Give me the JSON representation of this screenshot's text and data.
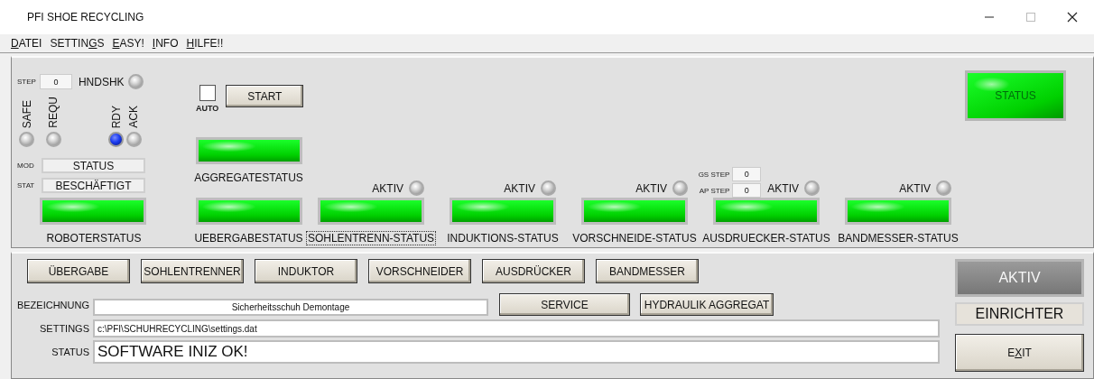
{
  "window": {
    "title": "PFI SHOE RECYCLING"
  },
  "menu": [
    {
      "key": "D",
      "rest": "ATEI"
    },
    {
      "lead": "SETTIN",
      "key": "G",
      "rest": "S"
    },
    {
      "key": "E",
      "rest": "ASY!"
    },
    {
      "key": "I",
      "rest": "NFO"
    },
    {
      "key": "H",
      "rest": "ILFE!!"
    }
  ],
  "robot": {
    "step_label": "STEP",
    "step": "0",
    "handshake_label": "HNDSHK",
    "handshake_on": false,
    "signals": [
      {
        "label": "SAFE",
        "on": false
      },
      {
        "label": "REQU",
        "on": false
      },
      {
        "label": "RDY",
        "on": true
      },
      {
        "label": "ACK",
        "on": false
      }
    ],
    "mod_label": "MOD",
    "mod": "STATUS",
    "stat_label": "STAT",
    "stat": "BESCHÄFTIGT",
    "status": {
      "label": "ROBOTERSTATUS",
      "on": true
    }
  },
  "start": {
    "auto_label": "AUTO",
    "auto_checked": false,
    "button": "START"
  },
  "aggregate": {
    "label": "AGGREGATESTATUS",
    "on": true
  },
  "transfer": {
    "label": "UEBERGABESTATUS",
    "on": true,
    "focused": false
  },
  "stations": [
    {
      "label": "SOHLENTRENN-STATUS",
      "on": true,
      "focused": true,
      "aktiv_label": "AKTIV",
      "aktiv_on": false
    },
    {
      "label": "INDUKTIONS-STATUS",
      "on": true,
      "focused": false,
      "aktiv_label": "AKTIV",
      "aktiv_on": false
    },
    {
      "label": "VORSCHNEIDE-STATUS",
      "on": true,
      "focused": false,
      "aktiv_label": "AKTIV",
      "aktiv_on": false
    },
    {
      "label": "AUSDRUECKER-STATUS",
      "on": true,
      "focused": false,
      "aktiv_label": "AKTIV",
      "aktiv_on": false,
      "steps": [
        {
          "label": "GS STEP",
          "value": "0"
        },
        {
          "label": "AP STEP",
          "value": "0"
        }
      ]
    },
    {
      "label": "BANDMESSER-STATUS",
      "on": true,
      "focused": false,
      "aktiv_label": "AKTIV",
      "aktiv_on": false
    }
  ],
  "main_status": {
    "label": "STATUS",
    "on": true
  },
  "station_buttons": [
    "ÜBERGABE",
    "SOHLENTRENNER",
    "INDUKTOR",
    "VORSCHNEIDER",
    "AUSDRÜCKER",
    "BANDMESSER"
  ],
  "bezeichnung": {
    "label": "BEZEICHNUNG",
    "value": "Sicherheitsschuh Demontage"
  },
  "service_buttons": [
    "SERVICE",
    "HYDRAULIK AGGREGAT"
  ],
  "settings": {
    "label": "SETTINGS",
    "value": "c:\\PFI\\SCHUHRECYCLING\\settings.dat"
  },
  "status": {
    "label": "STATUS",
    "value": "SOFTWARE INIZ OK!"
  },
  "aktiv_indicator": {
    "label": "AKTIV",
    "on": false
  },
  "mode": "EINRICHTER",
  "exit": {
    "lead": "E",
    "key": "X",
    "rest": "IT"
  }
}
